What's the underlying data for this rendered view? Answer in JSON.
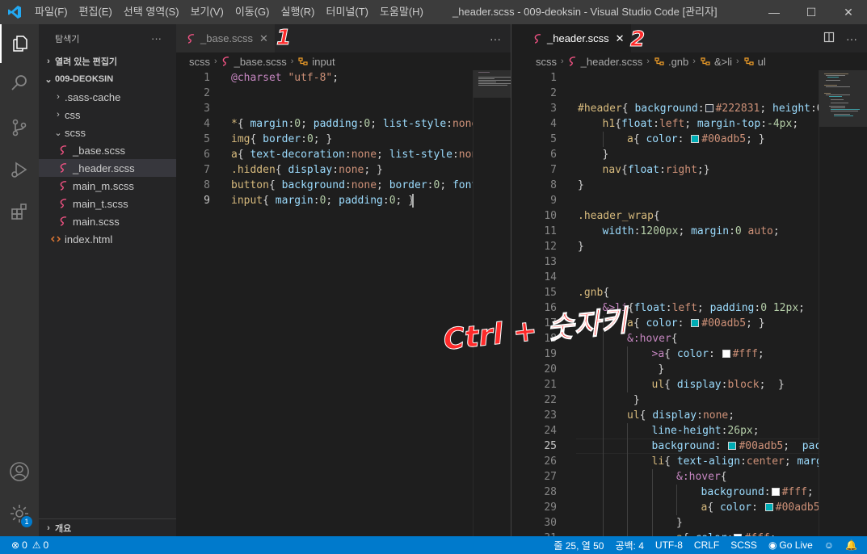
{
  "titlebar": {
    "menu": [
      "파일(F)",
      "편집(E)",
      "선택 영역(S)",
      "보기(V)",
      "이동(G)",
      "실행(R)",
      "터미널(T)",
      "도움말(H)"
    ],
    "title": "_header.scss - 009-deoksin - Visual Studio Code [관리자]",
    "minimize": "—",
    "maximize": "☐",
    "close": "✕"
  },
  "sidebar": {
    "title": "탐색기",
    "more": "···",
    "open_editors": "열려 있는 편집기",
    "project": "009-DEOKSIN",
    "tree": [
      {
        "label": ".sass-cache",
        "kind": "folder",
        "chev": "›"
      },
      {
        "label": "css",
        "kind": "folder",
        "chev": "›"
      },
      {
        "label": "scss",
        "kind": "folder",
        "chev": "⌄"
      },
      {
        "label": "_base.scss",
        "kind": "scss"
      },
      {
        "label": "_header.scss",
        "kind": "scss",
        "selected": true
      },
      {
        "label": "main_m.scss",
        "kind": "scss"
      },
      {
        "label": "main_t.scss",
        "kind": "scss"
      },
      {
        "label": "main.scss",
        "kind": "scss"
      },
      {
        "label": "index.html",
        "kind": "html"
      }
    ],
    "outline": "개요"
  },
  "editor1": {
    "tab": "_base.scss",
    "close": "✕",
    "more": "···",
    "breadcrumb": [
      "scss",
      "_base.scss",
      "input"
    ],
    "current_line": 9,
    "lines": [
      [
        [
          "c-at",
          "@charset "
        ],
        [
          "c-str",
          "\"utf-8\""
        ],
        [
          "c-pun",
          ";"
        ]
      ],
      [],
      [],
      [
        [
          "c-sel",
          "*"
        ],
        [
          "c-pun",
          "{ "
        ],
        [
          "c-prop",
          "margin"
        ],
        [
          "c-pun",
          ":"
        ],
        [
          "c-num",
          "0"
        ],
        [
          "c-pun",
          "; "
        ],
        [
          "c-prop",
          "padding"
        ],
        [
          "c-pun",
          ":"
        ],
        [
          "c-num",
          "0"
        ],
        [
          "c-pun",
          "; "
        ],
        [
          "c-prop",
          "list-style"
        ],
        [
          "c-pun",
          ":"
        ],
        [
          "c-val",
          "none"
        ]
      ],
      [
        [
          "c-tag",
          "img"
        ],
        [
          "c-pun",
          "{ "
        ],
        [
          "c-prop",
          "border"
        ],
        [
          "c-pun",
          ":"
        ],
        [
          "c-num",
          "0"
        ],
        [
          "c-pun",
          "; }"
        ]
      ],
      [
        [
          "c-tag",
          "a"
        ],
        [
          "c-pun",
          "{ "
        ],
        [
          "c-prop",
          "text-decoration"
        ],
        [
          "c-pun",
          ":"
        ],
        [
          "c-val",
          "none"
        ],
        [
          "c-pun",
          "; "
        ],
        [
          "c-prop",
          "list-style"
        ],
        [
          "c-pun",
          ":"
        ],
        [
          "c-val",
          "non"
        ]
      ],
      [
        [
          "c-cls",
          ".hidden"
        ],
        [
          "c-pun",
          "{ "
        ],
        [
          "c-prop",
          "display"
        ],
        [
          "c-pun",
          ":"
        ],
        [
          "c-val",
          "none"
        ],
        [
          "c-pun",
          "; }"
        ]
      ],
      [
        [
          "c-tag",
          "button"
        ],
        [
          "c-pun",
          "{ "
        ],
        [
          "c-prop",
          "background"
        ],
        [
          "c-pun",
          ":"
        ],
        [
          "c-val",
          "none"
        ],
        [
          "c-pun",
          "; "
        ],
        [
          "c-prop",
          "border"
        ],
        [
          "c-pun",
          ":"
        ],
        [
          "c-num",
          "0"
        ],
        [
          "c-pun",
          "; "
        ],
        [
          "c-prop",
          "font"
        ]
      ],
      [
        [
          "c-tag",
          "input"
        ],
        [
          "c-pun",
          "{ "
        ],
        [
          "c-prop",
          "margin"
        ],
        [
          "c-pun",
          ":"
        ],
        [
          "c-num",
          "0"
        ],
        [
          "c-pun",
          "; "
        ],
        [
          "c-prop",
          "padding"
        ],
        [
          "c-pun",
          ":"
        ],
        [
          "c-num",
          "0"
        ],
        [
          "c-pun",
          "; }"
        ]
      ]
    ]
  },
  "editor2": {
    "tab": "_header.scss",
    "close": "✕",
    "more": "···",
    "breadcrumb": [
      "scss",
      "_header.scss",
      ".gnb",
      "&>li",
      "ul"
    ],
    "current_line": 25,
    "first_line": 1,
    "lines": [
      {
        "i": 0,
        "t": []
      },
      {
        "i": 0,
        "t": []
      },
      {
        "i": 0,
        "t": [
          [
            "c-sel",
            "#header"
          ],
          [
            "c-pun",
            "{ "
          ],
          [
            "c-prop",
            "background"
          ],
          [
            "c-pun",
            ":"
          ],
          [
            "sw",
            "#222831"
          ],
          [
            "c-val",
            "#222831"
          ],
          [
            "c-pun",
            "; "
          ],
          [
            "c-prop",
            "height"
          ],
          [
            "c-pun",
            ":6"
          ]
        ]
      },
      {
        "i": 1,
        "t": [
          [
            "c-tag",
            "h1"
          ],
          [
            "c-pun",
            "{"
          ],
          [
            "c-prop",
            "float"
          ],
          [
            "c-pun",
            ":"
          ],
          [
            "c-val",
            "left"
          ],
          [
            "c-pun",
            "; "
          ],
          [
            "c-prop",
            "margin-top"
          ],
          [
            "c-pun",
            ":"
          ],
          [
            "c-num",
            "-4px"
          ],
          [
            "c-pun",
            ";"
          ]
        ]
      },
      {
        "i": 2,
        "t": [
          [
            "c-tag",
            "a"
          ],
          [
            "c-pun",
            "{ "
          ],
          [
            "c-prop",
            "color"
          ],
          [
            "c-pun",
            ": "
          ],
          [
            "sw",
            "#00adb5"
          ],
          [
            "c-val",
            "#00adb5"
          ],
          [
            "c-pun",
            "; }"
          ]
        ]
      },
      {
        "i": 1,
        "t": [
          [
            "c-pun",
            "}"
          ]
        ]
      },
      {
        "i": 1,
        "t": [
          [
            "c-tag",
            "nav"
          ],
          [
            "c-pun",
            "{"
          ],
          [
            "c-prop",
            "float"
          ],
          [
            "c-pun",
            ":"
          ],
          [
            "c-val",
            "right"
          ],
          [
            "c-pun",
            ";}"
          ]
        ]
      },
      {
        "i": 0,
        "t": [
          [
            "c-pun",
            "}"
          ]
        ]
      },
      {
        "i": 0,
        "t": []
      },
      {
        "i": 0,
        "t": [
          [
            "c-cls",
            ".header_wrap"
          ],
          [
            "c-pun",
            "{"
          ]
        ]
      },
      {
        "i": 1,
        "t": [
          [
            "c-prop",
            "width"
          ],
          [
            "c-pun",
            ":"
          ],
          [
            "c-num",
            "1200px"
          ],
          [
            "c-pun",
            "; "
          ],
          [
            "c-prop",
            "margin"
          ],
          [
            "c-pun",
            ":"
          ],
          [
            "c-num",
            "0"
          ],
          [
            "c-val",
            " auto"
          ],
          [
            "c-pun",
            ";"
          ]
        ]
      },
      {
        "i": 0,
        "t": [
          [
            "c-pun",
            "}"
          ]
        ]
      },
      {
        "i": 0,
        "t": []
      },
      {
        "i": 0,
        "t": []
      },
      {
        "i": 0,
        "t": [
          [
            "c-cls",
            ".gnb"
          ],
          [
            "c-pun",
            "{"
          ]
        ]
      },
      {
        "i": 1,
        "t": [
          [
            "c-amp",
            "&>li"
          ],
          [
            "c-pun",
            "{"
          ],
          [
            "c-prop",
            "float"
          ],
          [
            "c-pun",
            ":"
          ],
          [
            "c-val",
            "left"
          ],
          [
            "c-pun",
            "; "
          ],
          [
            "c-prop",
            "padding"
          ],
          [
            "c-pun",
            ":"
          ],
          [
            "c-num",
            "0 12px"
          ],
          [
            "c-pun",
            ";"
          ]
        ]
      },
      {
        "i": 2,
        "t": [
          [
            "c-tag",
            "a"
          ],
          [
            "c-pun",
            "{ "
          ],
          [
            "c-prop",
            "color"
          ],
          [
            "c-pun",
            ": "
          ],
          [
            "sw",
            "#00adb5"
          ],
          [
            "c-val",
            "#00adb5"
          ],
          [
            "c-pun",
            "; }"
          ]
        ]
      },
      {
        "i": 2,
        "t": [
          [
            "c-amp",
            "&:hover"
          ],
          [
            "c-pun",
            "{"
          ]
        ]
      },
      {
        "i": 3,
        "t": [
          [
            "c-amp",
            ">a"
          ],
          [
            "c-pun",
            "{ "
          ],
          [
            "c-prop",
            "color"
          ],
          [
            "c-pun",
            ": "
          ],
          [
            "sw",
            "#ffffff"
          ],
          [
            "c-val",
            "#fff"
          ],
          [
            "c-pun",
            ";"
          ]
        ]
      },
      {
        "i": 3,
        "t": [
          [
            "c-pun",
            " }"
          ]
        ]
      },
      {
        "i": 3,
        "t": [
          [
            "c-tag",
            "ul"
          ],
          [
            "c-pun",
            "{ "
          ],
          [
            "c-prop",
            "display"
          ],
          [
            "c-pun",
            ":"
          ],
          [
            "c-val",
            "block"
          ],
          [
            "c-pun",
            ";  }"
          ]
        ]
      },
      {
        "i": 2,
        "t": [
          [
            "c-pun",
            " }"
          ]
        ]
      },
      {
        "i": 2,
        "t": [
          [
            "c-tag",
            "ul"
          ],
          [
            "c-pun",
            "{ "
          ],
          [
            "c-prop",
            "display"
          ],
          [
            "c-pun",
            ":"
          ],
          [
            "c-val",
            "none"
          ],
          [
            "c-pun",
            ";"
          ]
        ]
      },
      {
        "i": 3,
        "t": [
          [
            "c-prop",
            "line-height"
          ],
          [
            "c-pun",
            ":"
          ],
          [
            "c-num",
            "26px"
          ],
          [
            "c-pun",
            ";"
          ]
        ]
      },
      {
        "i": 3,
        "t": [
          [
            "c-prop",
            "background"
          ],
          [
            "c-pun",
            ": "
          ],
          [
            "sw",
            "#00adb5"
          ],
          [
            "c-val",
            "#00adb5"
          ],
          [
            "c-pun",
            ";  "
          ],
          [
            "c-prop",
            "pac"
          ]
        ]
      },
      {
        "i": 3,
        "t": [
          [
            "c-tag",
            "li"
          ],
          [
            "c-pun",
            "{ "
          ],
          [
            "c-prop",
            "text-align"
          ],
          [
            "c-pun",
            ":"
          ],
          [
            "c-val",
            "center"
          ],
          [
            "c-pun",
            "; "
          ],
          [
            "c-prop",
            "marg"
          ]
        ]
      },
      {
        "i": 4,
        "t": [
          [
            "c-amp",
            "&:hover"
          ],
          [
            "c-pun",
            "{"
          ]
        ]
      },
      {
        "i": 5,
        "t": [
          [
            "c-prop",
            "background"
          ],
          [
            "c-pun",
            ":"
          ],
          [
            "sw",
            "#ffffff"
          ],
          [
            "c-val",
            "#fff"
          ],
          [
            "c-pun",
            ";"
          ]
        ]
      },
      {
        "i": 5,
        "t": [
          [
            "c-tag",
            "a"
          ],
          [
            "c-pun",
            "{ "
          ],
          [
            "c-prop",
            "color"
          ],
          [
            "c-pun",
            ": "
          ],
          [
            "sw",
            "#00adb5"
          ],
          [
            "c-val",
            "#00adb5"
          ]
        ]
      },
      {
        "i": 4,
        "t": [
          [
            "c-pun",
            "}"
          ]
        ]
      },
      {
        "i": 4,
        "t": [
          [
            "c-tag",
            "a"
          ],
          [
            "c-pun",
            "{ "
          ],
          [
            "c-prop",
            "color"
          ],
          [
            "c-pun",
            ":"
          ],
          [
            "sw",
            "#ffffff"
          ],
          [
            "c-val",
            "#fff"
          ],
          [
            "c-pun",
            ";"
          ]
        ]
      }
    ]
  },
  "annotations": {
    "tab1": "1",
    "tab2": "2",
    "hint": "Ctrl + 숫자키"
  },
  "statusbar": {
    "errors": "0",
    "warnings": "0",
    "position": "줄 25, 열 50",
    "spaces": "공백: 4",
    "encoding": "UTF-8",
    "eol": "CRLF",
    "language": "SCSS",
    "golive": "Go Live"
  },
  "badges": {
    "settings": "1"
  },
  "colors": {
    "accent": "#007acc",
    "teal": "#00adb5",
    "dark": "#222831"
  }
}
